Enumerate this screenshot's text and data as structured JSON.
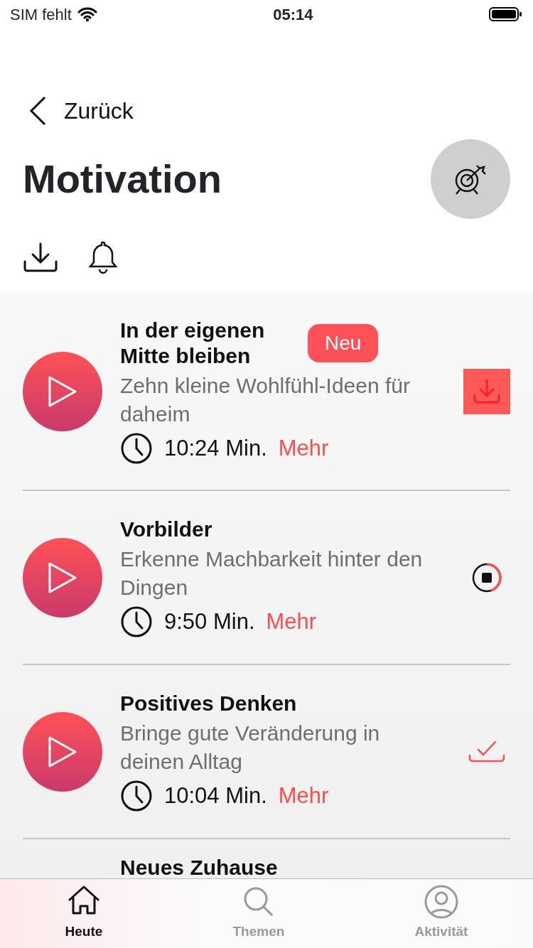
{
  "status_bar": {
    "carrier": "SIM fehlt",
    "time": "05:14"
  },
  "nav": {
    "back_label": "Zurück"
  },
  "title": "Motivation",
  "episodes": [
    {
      "title": "In der eigenen Mitte bleiben",
      "badge": "Neu",
      "subtitle": "Zehn kleine Wohlfühl-Ideen für daheim",
      "duration": "10:24 Min.",
      "more": "Mehr",
      "kind": "download"
    },
    {
      "title": "Vorbilder",
      "subtitle": "Erkenne Machbarkeit hinter den Dingen",
      "duration": "9:50 Min.",
      "more": "Mehr",
      "kind": "downloading",
      "level": 0.45
    },
    {
      "title": "Positives Denken",
      "subtitle": "Bringe gute Veränderung in deinen Alltag",
      "duration": "10:04 Min.",
      "more": "Mehr",
      "kind": "downloaded"
    },
    {
      "title": "Neues Zuhause",
      "kind": "partial"
    }
  ],
  "tabs": [
    {
      "label": "Heute",
      "selected": true
    },
    {
      "label": "Themen",
      "selected": false
    },
    {
      "label": "Aktivität",
      "selected": false
    }
  ]
}
